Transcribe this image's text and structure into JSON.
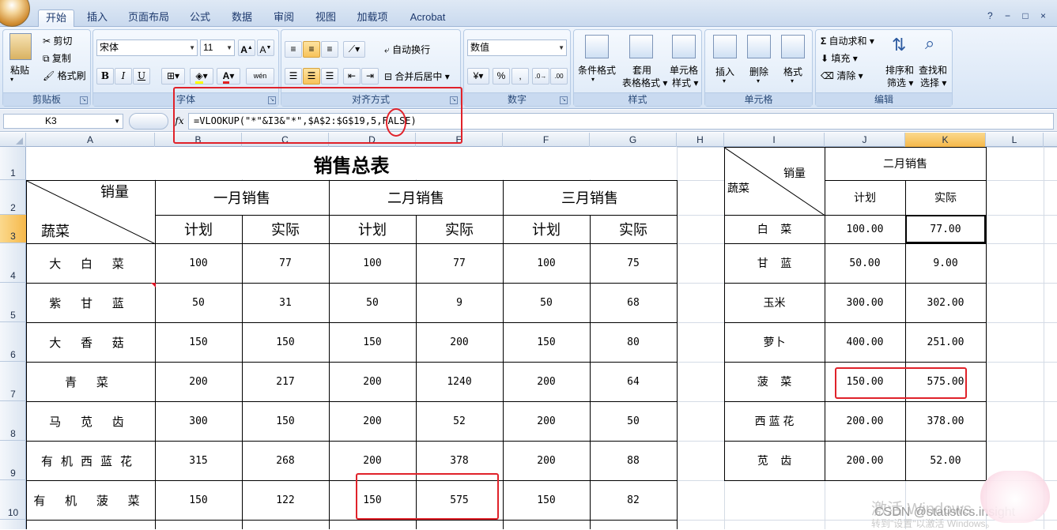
{
  "ribbon": {
    "tabs": [
      "开始",
      "插入",
      "页面布局",
      "公式",
      "数据",
      "审阅",
      "视图",
      "加载项",
      "Acrobat"
    ],
    "active_tab": "开始",
    "right_icons": "? − □ ×",
    "clipboard": {
      "paste": "粘贴",
      "cut": "剪切",
      "copy": "复制",
      "format_painter": "格式刷",
      "title": "剪贴板"
    },
    "font": {
      "name": "宋体",
      "size": "11",
      "bold": "B",
      "italic": "I",
      "underline": "U",
      "wen": "wén",
      "title": "字体"
    },
    "alignment": {
      "wrap_text": "自动换行",
      "merge_center": "合并后居中",
      "title": "对齐方式"
    },
    "number": {
      "format": "数值",
      "percent": "%",
      "title": "数字"
    },
    "styles": {
      "conditional": "条件格式",
      "table_fmt_1": "套用",
      "table_fmt_2": "表格格式",
      "cell_style_1": "单元格",
      "cell_style_2": "样式",
      "title": "样式"
    },
    "cells": {
      "insert": "插入",
      "delete": "删除",
      "format": "格式",
      "title": "单元格"
    },
    "editing": {
      "autosum": "自动求和",
      "fill": "填充",
      "clear": "清除",
      "sort_1": "排序和",
      "sort_2": "筛选",
      "find_1": "查找和",
      "find_2": "选择",
      "title": "编辑"
    }
  },
  "formula_bar": {
    "name_box": "K3",
    "fx": "fx",
    "formula": "=VLOOKUP(\"*\"&I3&\"*\",$A$2:$G$19,5,FALSE)"
  },
  "columns": [
    "A",
    "B",
    "C",
    "D",
    "E",
    "F",
    "G",
    "H",
    "I",
    "J",
    "K",
    "L"
  ],
  "selected_column": "K",
  "rows": [
    "1",
    "2",
    "3",
    "4",
    "5",
    "6",
    "7",
    "8",
    "9",
    "10"
  ],
  "selected_row": "3",
  "main_table": {
    "title": "销售总表",
    "diag_top": "销量",
    "diag_bottom": "蔬菜",
    "months": [
      "一月销售",
      "二月销售",
      "三月销售"
    ],
    "sub": [
      "计划",
      "实际",
      "计划",
      "实际",
      "计划",
      "实际"
    ],
    "rows": [
      {
        "name": "大 白 菜",
        "v": [
          "100",
          "77",
          "100",
          "77",
          "100",
          "75"
        ]
      },
      {
        "name": "紫 甘 蓝",
        "v": [
          "50",
          "31",
          "50",
          "9",
          "50",
          "68"
        ]
      },
      {
        "name": "大 香 菇",
        "v": [
          "150",
          "150",
          "150",
          "200",
          "150",
          "80"
        ]
      },
      {
        "name": "青   菜",
        "v": [
          "200",
          "217",
          "200",
          "1240",
          "200",
          "64"
        ]
      },
      {
        "name": "马 苋 齿",
        "v": [
          "300",
          "150",
          "200",
          "52",
          "200",
          "50"
        ]
      },
      {
        "name": "有机西蓝花",
        "v": [
          "315",
          "268",
          "200",
          "378",
          "200",
          "88"
        ]
      },
      {
        "name": "有 机 菠 菜",
        "v": [
          "150",
          "122",
          "150",
          "575",
          "150",
          "82"
        ]
      }
    ]
  },
  "lookup_table": {
    "diag_top": "销量",
    "diag_bottom": "蔬菜",
    "month": "二月销售",
    "sub": [
      "计划",
      "实际"
    ],
    "rows": [
      {
        "name": "白    菜",
        "plan": "100.00",
        "actual": "77.00"
      },
      {
        "name": "甘    蓝",
        "plan": "50.00",
        "actual": "9.00"
      },
      {
        "name": "玉米",
        "plan": "300.00",
        "actual": "302.00"
      },
      {
        "name": "萝卜",
        "plan": "400.00",
        "actual": "251.00"
      },
      {
        "name": "菠    菜",
        "plan": "150.00",
        "actual": "575.00"
      },
      {
        "name": "西 蓝 花",
        "plan": "200.00",
        "actual": "378.00"
      },
      {
        "name": "苋    齿",
        "plan": "200.00",
        "actual": "52.00"
      }
    ]
  },
  "watermark": {
    "activate": "激活 Windows",
    "goto": "转到\"设置\"以激活 Windows。",
    "csdn": "CSDN @statistics.insight"
  },
  "colors": {
    "annotation_red": "#e0222a",
    "selection_orange": "#f5b84a"
  }
}
